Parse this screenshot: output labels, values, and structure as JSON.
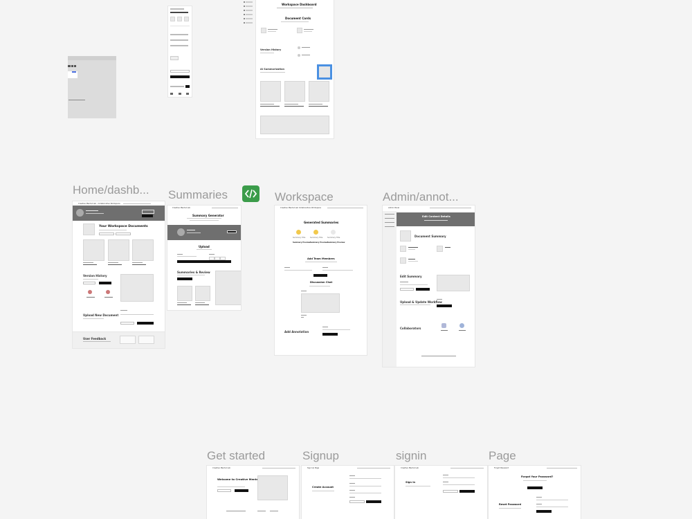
{
  "labels": {
    "home": "Home/dashb...",
    "summaries": "Summaries",
    "workspace": "Workspace",
    "admin": "Admin/annot...",
    "get_started": "Get started",
    "signup": "Signup",
    "signin": "signin",
    "page": "Page"
  },
  "top": {
    "dashboard_title": "Workspace Dashboard",
    "document_cards": "Document Cards",
    "version_history": "Version History",
    "ai_summarization": "AI Summarization"
  },
  "home": {
    "org": "Creative Mental Lab - Collaborative Workspace",
    "workspace_documents": "Your Workspace Documents",
    "version_history": "Version History",
    "upload_new_document": "Upload New Document",
    "user_feedback": "User Feedback"
  },
  "summaries": {
    "org": "Creative Mental Lab",
    "generator": "Summary Generator",
    "upload": "Upload",
    "summaries_review": "Summaries & Review"
  },
  "workspace": {
    "org": "Creative Mental Lab Collaborative Workspace",
    "generated": "Generated Summaries",
    "members": [
      "Summary Title",
      "Summary Title",
      "Summary Title"
    ],
    "names": [
      "Summary Preview",
      "Summary Preview",
      "Summary Preview"
    ],
    "add_team": "Add Team Members",
    "chat": "Discussion Chat",
    "annotation": "Add Annotation"
  },
  "admin": {
    "org": "Admin Panel",
    "edit_content": "Edit Content Details",
    "document_summary": "Document Summary",
    "edit_summary": "Edit Summary",
    "upload_workflow": "Upload & Update Workflow",
    "collaborators": "Collaborators"
  },
  "get_started": {
    "org": "Creative Mental Lab",
    "welcome": "Welcome to Creative Mental Lab"
  },
  "signup": {
    "org": "Sign Up Page",
    "create": "Create Account"
  },
  "signin": {
    "org": "Creative Mental Lab",
    "title": "Sign In"
  },
  "page": {
    "org": "Forgot Password",
    "forgot": "Forgot Your Password?",
    "reset": "Reset Password"
  },
  "colors": {
    "selection": "#4a90e2",
    "code_badge": "#3b9c4a",
    "hero": "#6f6f6f"
  }
}
